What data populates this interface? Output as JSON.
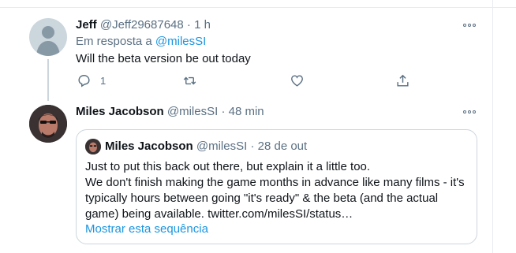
{
  "reply_tweet": {
    "author_name": "Jeff",
    "handle": "@Jeff29687648",
    "separator": "·",
    "time": "1 h",
    "replying_prefix": "Em resposta a",
    "replying_to": "@milesSI",
    "text": "Will the beta version be out today",
    "actions": {
      "reply_count": "1"
    }
  },
  "main_tweet": {
    "author_name": "Miles Jacobson",
    "handle": "@milesSI",
    "separator": "·",
    "time": "48 min",
    "quoted_tweet": {
      "author_name": "Miles Jacobson",
      "handle": "@milesSI",
      "separator": "·",
      "date": "28 de out",
      "text": "Just to put this back out there, but explain it a little too.\nWe don't finish making the game months in advance like many films - it's typically hours between going \"it's ready\" & the beta (and the actual game) being available. twitter.com/milesSI/status…",
      "show_thread_link": "Mostrar esta sequência"
    }
  },
  "colors": {
    "link": "#1b95e0",
    "muted": "#5b7083",
    "border": "#ccd6dd"
  }
}
